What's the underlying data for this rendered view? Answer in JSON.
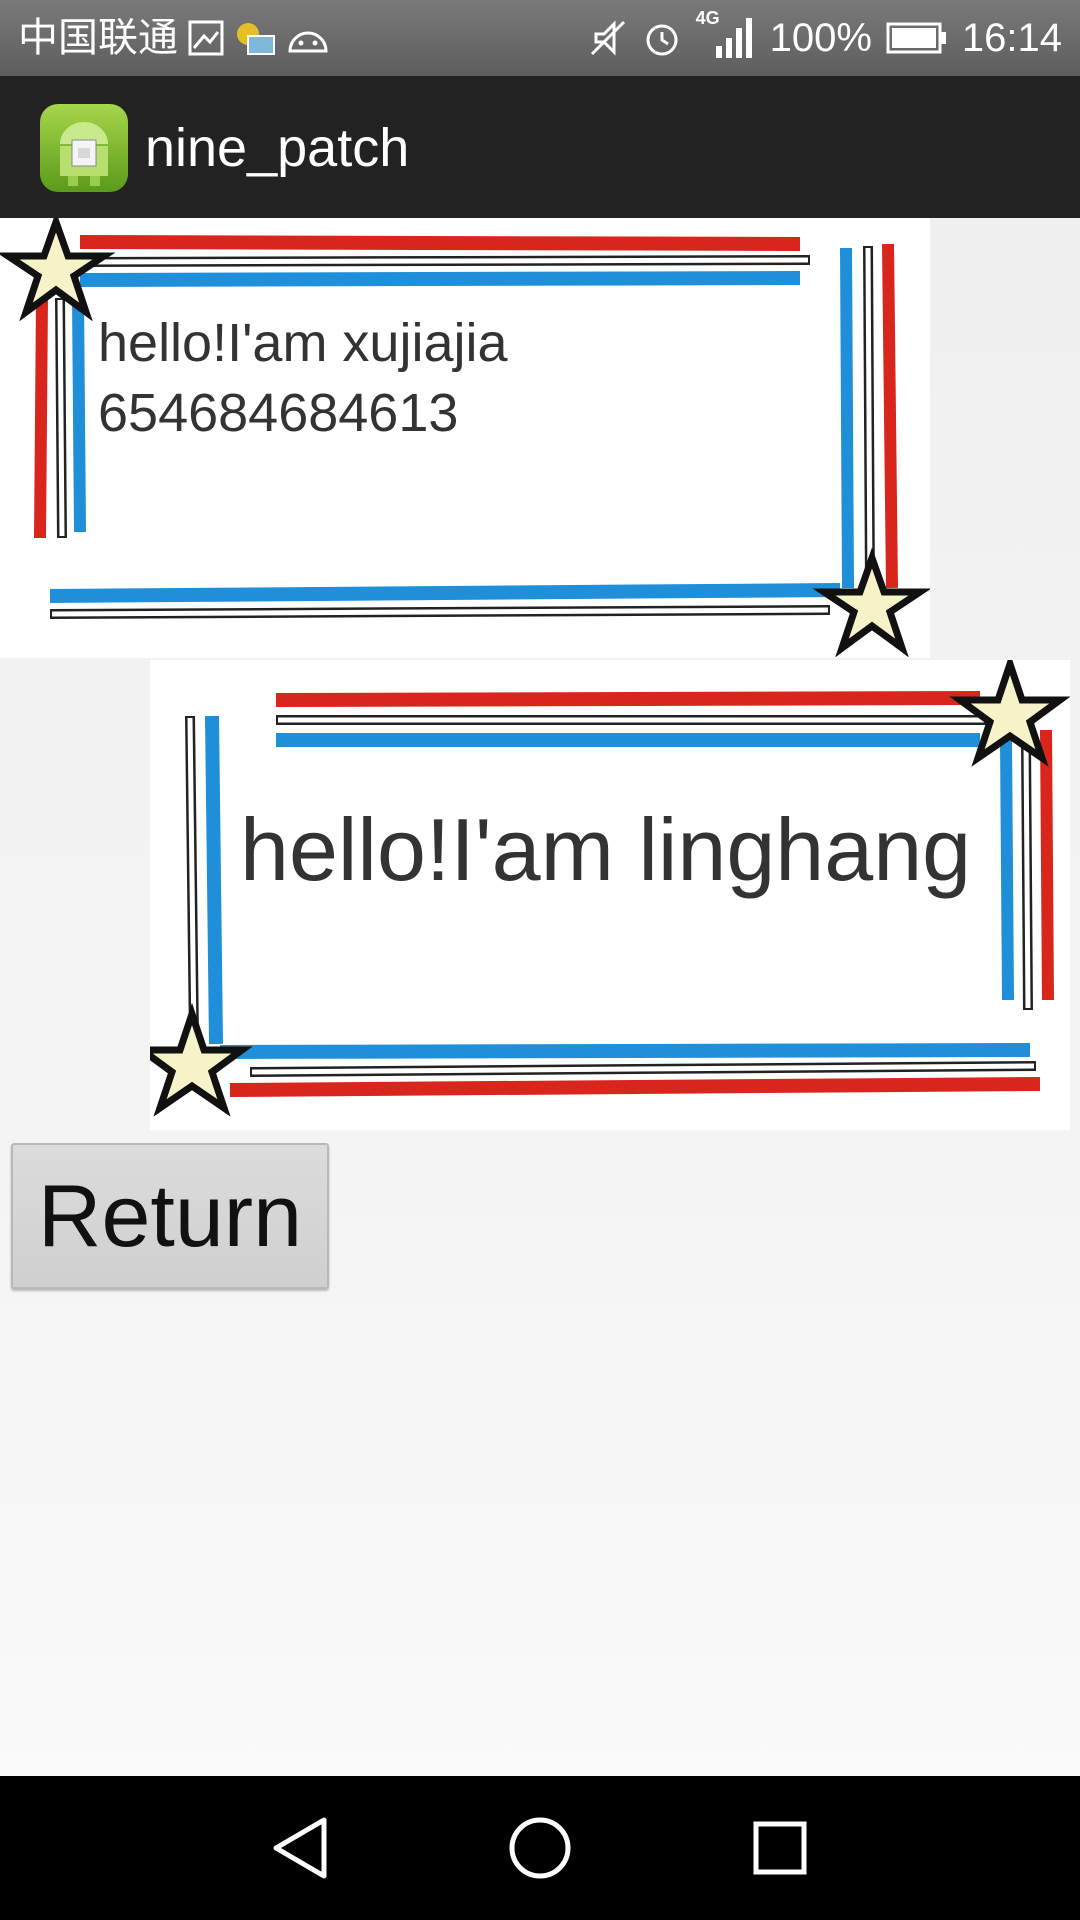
{
  "status_bar": {
    "carrier": "中国联通",
    "network": "4G",
    "battery": "100%",
    "time": "16:14",
    "icons": [
      "gallery-icon",
      "email-icon",
      "android-icon",
      "mute-icon",
      "alarm-icon",
      "signal-icon",
      "battery-icon"
    ]
  },
  "action_bar": {
    "title": "nine_patch",
    "icon": "android-app-icon"
  },
  "frames": [
    {
      "line1": "hello!I'am xujiajia",
      "line2": "654684684613"
    },
    {
      "text": "hello!I'am linghang"
    }
  ],
  "return_button": {
    "label": "Return"
  },
  "nav_bar": {
    "icons": [
      "back-icon",
      "home-icon",
      "recents-icon"
    ]
  },
  "colors": {
    "frame_red": "#d9261c",
    "frame_blue": "#1e8fd8",
    "star_fill": "#f7f3c8",
    "action_bar": "#222222"
  }
}
